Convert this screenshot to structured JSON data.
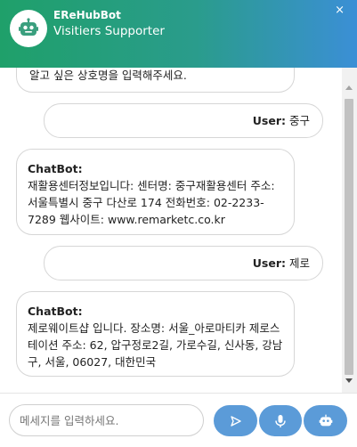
{
  "header": {
    "title": "EReHubBot",
    "subtitle": "Visitiers Supporter",
    "close_label": "×"
  },
  "messages": {
    "partial_text": "알고 싶은 상호명을 입력해주세요.",
    "user1": {
      "sender": "User:",
      "text": "중구"
    },
    "bot1": {
      "sender": "ChatBot:",
      "text": "재활용센터정보입니다: 센터명: 중구재활용센터 주소: 서울특별시 중구 다산로 174 전화번호: 02-2233-7289 웹사이트: www.remarketc.co.kr"
    },
    "user2": {
      "sender": "User:",
      "text": "제로"
    },
    "bot2": {
      "sender": "ChatBot:",
      "text": "제로웨이트샵 입니다. 장소명: 서울_아로마티카 제로스테이션 주소: 62, 압구정로2길, 가로수길, 신사동, 강남구, 서울, 06027, 대한민국"
    }
  },
  "input": {
    "placeholder": "메세지를 입력하세요.",
    "value": ""
  },
  "icons": {
    "avatar": "robot-icon",
    "send": "send-icon",
    "voice": "microphone-icon",
    "bot": "robot-icon"
  },
  "colors": {
    "header_start": "#1fa06a",
    "header_end": "#3b8fd6",
    "button": "#5b9bd8"
  }
}
